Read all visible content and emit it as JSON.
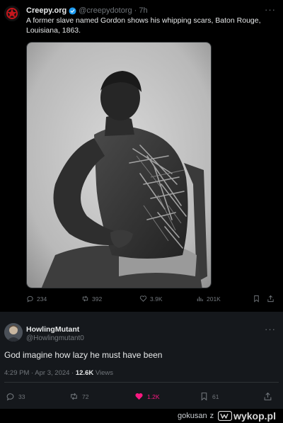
{
  "tweet1": {
    "author_name": "Creepy.org",
    "author_handle": "@creepydotorg",
    "time": "· 7h",
    "text": "A former slave named Gordon shows his whipping scars, Baton Rouge, Louisiana, 1863.",
    "more": "···",
    "actions": {
      "replies": "234",
      "retweets": "392",
      "likes": "3.9K",
      "views": "201K"
    }
  },
  "tweet2": {
    "author_name": "HowlingMutant",
    "author_handle": "@Howlingmutant0",
    "more": "···",
    "text": "God imagine how lazy he must have been",
    "timestamp": "4:29 PM · Apr 3, 2024 · ",
    "views_count": "12.6K",
    "views_label": " Views",
    "actions": {
      "replies": "33",
      "retweets": "72",
      "likes": "1.2K",
      "bookmarks": "61"
    },
    "like_color": "#f91880"
  },
  "footer": {
    "credit_user": "gokusan",
    "credit_sep": "z",
    "site": "wykop.pl"
  },
  "colors": {
    "background": "#000000",
    "reply_background": "#15181c",
    "muted": "#71767b",
    "verified": "#1d9bf0",
    "text": "#e7e9ea"
  }
}
